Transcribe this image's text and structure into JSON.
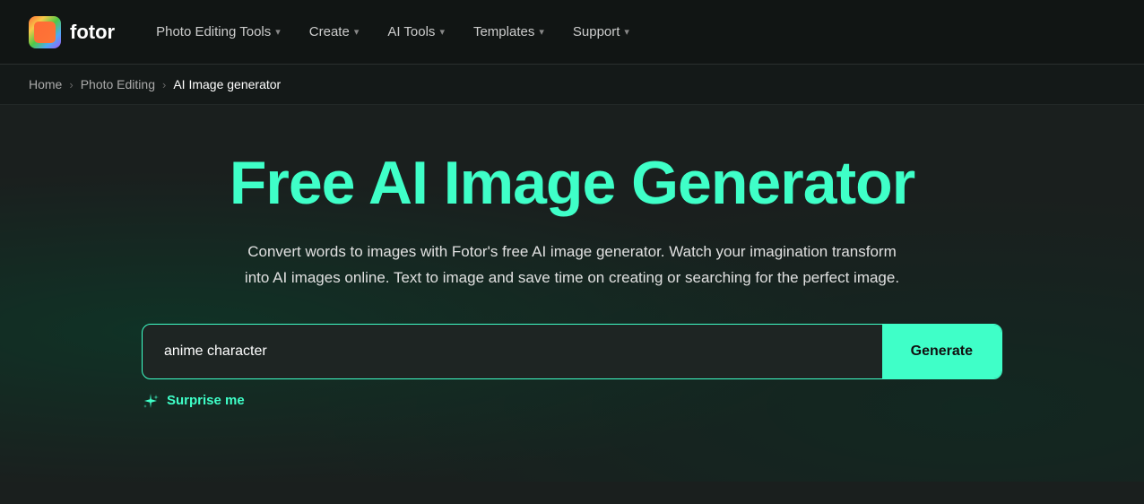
{
  "logo": {
    "text": "fotor"
  },
  "nav": {
    "items": [
      {
        "label": "Photo Editing Tools",
        "id": "photo-editing-tools"
      },
      {
        "label": "Create",
        "id": "create"
      },
      {
        "label": "AI Tools",
        "id": "ai-tools"
      },
      {
        "label": "Templates",
        "id": "templates"
      },
      {
        "label": "Support",
        "id": "support"
      }
    ]
  },
  "breadcrumb": {
    "items": [
      {
        "label": "Home",
        "id": "home",
        "active": false
      },
      {
        "label": "Photo Editing",
        "id": "photo-editing",
        "active": false
      },
      {
        "label": "AI Image generator",
        "id": "ai-image-generator",
        "active": true
      }
    ]
  },
  "hero": {
    "title": "Free AI Image Generator",
    "subtitle": "Convert words to images with Fotor's free AI image generator. Watch your imagination transform into AI images online. Text to image and save time on creating or searching for the perfect image."
  },
  "input": {
    "placeholder": "anime character",
    "value": "anime character",
    "generate_label": "Generate",
    "surprise_label": "Surprise me"
  }
}
